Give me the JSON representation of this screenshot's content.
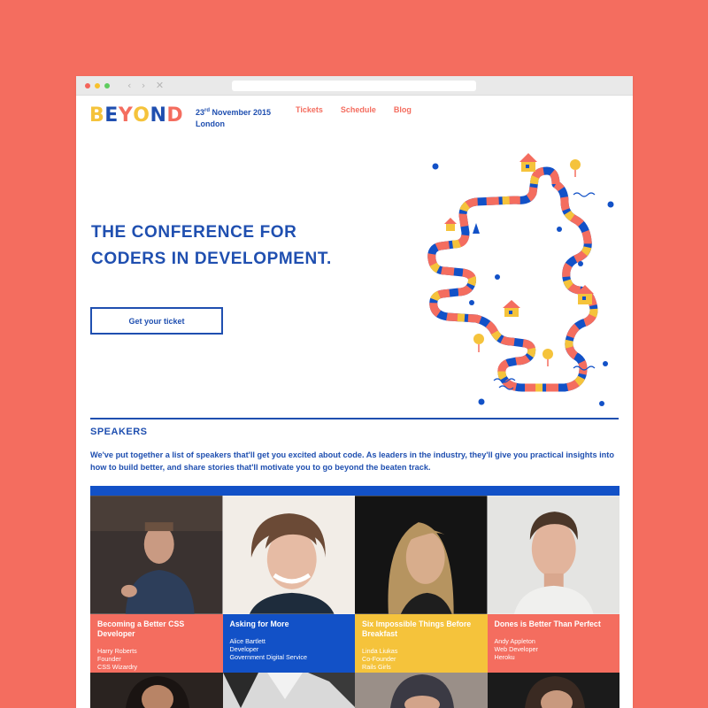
{
  "browser": {
    "nav_icons": [
      "‹",
      "›",
      "✕"
    ]
  },
  "header": {
    "logo_letters": [
      {
        "ch": "B",
        "color": "#f5c33b"
      },
      {
        "ch": "E",
        "color": "#1f4fb0"
      },
      {
        "ch": "Y",
        "color": "#f46d5f"
      },
      {
        "ch": "O",
        "color": "#f5c33b"
      },
      {
        "ch": "N",
        "color": "#1f4fb0"
      },
      {
        "ch": "D",
        "color": "#f46d5f"
      }
    ],
    "date_day": "23",
    "date_suffix": "rd",
    "date_rest": " November 2015",
    "location": "London",
    "nav": [
      "Tickets",
      "Schedule",
      "Blog"
    ]
  },
  "hero": {
    "headline_line1": "THE CONFERENCE FOR",
    "headline_line2": "CODERS IN DEVELOPMENT.",
    "cta": "Get your ticket"
  },
  "speakers": {
    "title": "SPEAKERS",
    "description": "We've put together a list of speakers that'll get you excited about code. As leaders in the industry, they'll give you practical insights into how to build better, and share stories that'll motivate you to go beyond the beaten track.",
    "cards": [
      {
        "talk": "Becoming a Better CSS Developer",
        "name": "Harry Roberts",
        "role": "Founder",
        "company": "CSS Wizardry",
        "color": "#f46d5f"
      },
      {
        "talk": "Asking for More",
        "name": "Alice Bartlett",
        "role": "Developer",
        "company": "Government Digital Service",
        "color": "#1251c7"
      },
      {
        "talk": "Six Impossible Things Before Breakfast",
        "name": "Linda Liukas",
        "role": "Co-Founder",
        "company": "Rails Girls",
        "color": "#f5c33b"
      },
      {
        "talk": "Dones is Better Than Perfect",
        "name": "Andy Appleton",
        "role": "Web Developer",
        "company": "Heroku",
        "color": "#f46d5f"
      }
    ]
  },
  "colors": {
    "accent_blue": "#1f4fb0",
    "coral": "#f46d5f",
    "yellow": "#f5c33b"
  }
}
